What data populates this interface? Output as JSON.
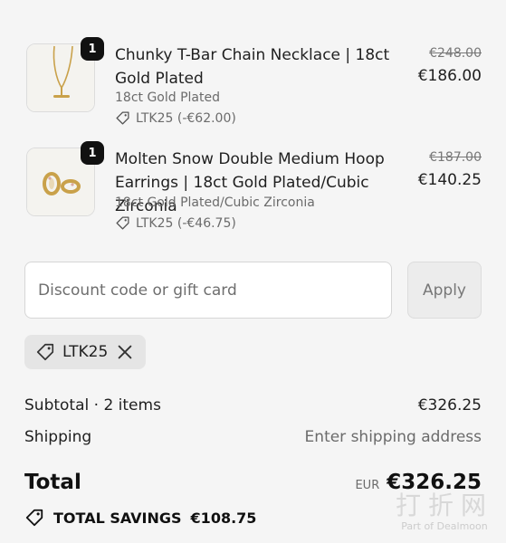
{
  "cart": {
    "items": [
      {
        "quantity": "1",
        "name": "Chunky T-Bar Chain Necklace | 18ct Gold Plated",
        "variant": "18ct Gold Plated",
        "discount": "LTK25 (-€62.00)",
        "original_price": "€248.00",
        "price": "€186.00",
        "image_icon": "necklace-icon"
      },
      {
        "quantity": "1",
        "name": "Molten Snow Double Medium Hoop Earrings | 18ct Gold Plated/Cubic Zirconia",
        "variant": "18ct Gold Plated/Cubic Zirconia",
        "discount": "LTK25 (-€46.75)",
        "original_price": "€187.00",
        "price": "€140.25",
        "image_icon": "earrings-icon"
      }
    ]
  },
  "discount": {
    "placeholder": "Discount code or gift card",
    "apply_label": "Apply",
    "applied_code": "LTK25"
  },
  "summary": {
    "subtotal_label": "Subtotal · 2 items",
    "subtotal_value": "€326.25",
    "shipping_label": "Shipping",
    "shipping_value": "Enter shipping address",
    "total_label": "Total",
    "currency": "EUR",
    "total_value": "€326.25",
    "savings_label": "TOTAL SAVINGS",
    "savings_value": "€108.75"
  },
  "watermark": {
    "title": "打折网",
    "subtitle": "Part of Dealmoon"
  },
  "colors": {
    "background": "#f5f5f5",
    "text": "#1f1f1f",
    "muted": "#6b6b6b",
    "badge": "#111111",
    "gold": "#c9a14a"
  }
}
